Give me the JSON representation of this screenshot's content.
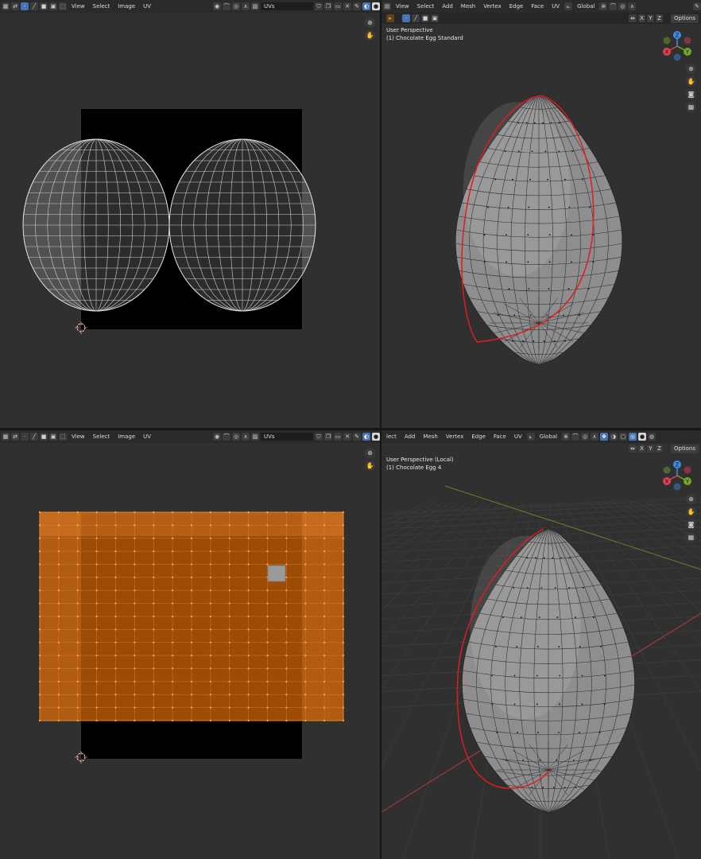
{
  "uv_editor_top": {
    "menus": [
      "View",
      "Select",
      "Image",
      "UV"
    ],
    "uv_map": "UVs"
  },
  "viewport_top": {
    "menus": [
      "View",
      "Select",
      "Add",
      "Mesh",
      "Vertex",
      "Edge",
      "Face",
      "UV"
    ],
    "transform_orientation": "Global",
    "axes": [
      "X",
      "Y",
      "Z"
    ],
    "options_label": "Options",
    "perspective": "User Perspective",
    "object_name": "(1) Chocolate Egg Standard"
  },
  "uv_editor_bottom": {
    "menus": [
      "View",
      "Select",
      "Image",
      "UV"
    ],
    "uv_map": "UVs"
  },
  "viewport_bottom": {
    "menus_lead": "lect",
    "menus": [
      "Add",
      "Mesh",
      "Vertex",
      "Edge",
      "Face",
      "UV"
    ],
    "transform_orientation": "Global",
    "axes": [
      "X",
      "Y",
      "Z"
    ],
    "options_label": "Options",
    "perspective": "User Perspective (Local)",
    "object_name": "(1) Chocolate Egg 4"
  },
  "gizmo": {
    "x": "X",
    "y": "Y",
    "z": "Z"
  },
  "colors": {
    "background": "#303030",
    "header": "#2a2a2a",
    "accent": "#4772b3",
    "selected_uv": "#9c4c06",
    "seam": "#e01c1c",
    "axis_x": "#e0404f",
    "axis_y": "#75a82a",
    "axis_z": "#3b8fe6"
  }
}
